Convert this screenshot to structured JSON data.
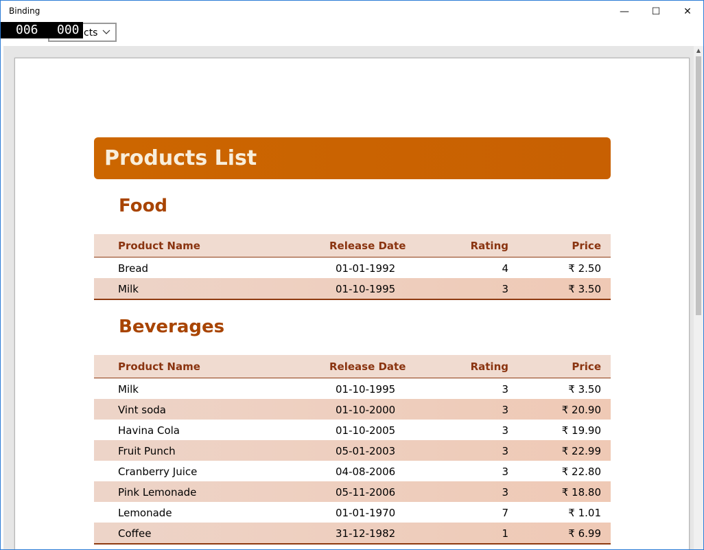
{
  "window": {
    "title": "Binding"
  },
  "controls": {
    "minimize": "—",
    "maximize": "☐",
    "close": "✕"
  },
  "fps": {
    "a": "006",
    "b": "000"
  },
  "dropdown": {
    "value_fragment": "cts",
    "chevron": "chevron-down-icon"
  },
  "report": {
    "banner_title": "Products List",
    "columns": {
      "name": "Product Name",
      "date": "Release Date",
      "rating": "Rating",
      "price": "Price"
    },
    "sections": [
      {
        "title": "Food",
        "rows": [
          {
            "name": "Bread",
            "date": "01-01-1992",
            "rating": "4",
            "price": "₹ 2.50"
          },
          {
            "name": "Milk",
            "date": "01-10-1995",
            "rating": "3",
            "price": "₹ 3.50"
          }
        ]
      },
      {
        "title": "Beverages",
        "rows": [
          {
            "name": "Milk",
            "date": "01-10-1995",
            "rating": "3",
            "price": "₹ 3.50"
          },
          {
            "name": "Vint soda",
            "date": "01-10-2000",
            "rating": "3",
            "price": "₹ 20.90"
          },
          {
            "name": "Havina Cola",
            "date": "01-10-2005",
            "rating": "3",
            "price": "₹ 19.90"
          },
          {
            "name": "Fruit Punch",
            "date": "05-01-2003",
            "rating": "3",
            "price": "₹ 22.99"
          },
          {
            "name": "Cranberry Juice",
            "date": "04-08-2006",
            "rating": "3",
            "price": "₹ 22.80"
          },
          {
            "name": "Pink Lemonade",
            "date": "05-11-2006",
            "rating": "3",
            "price": "₹ 18.80"
          },
          {
            "name": "Lemonade",
            "date": "01-01-1970",
            "rating": "7",
            "price": "₹ 1.01"
          },
          {
            "name": "Coffee",
            "date": "31-12-1982",
            "rating": "1",
            "price": "₹ 6.99"
          }
        ]
      }
    ]
  },
  "colors": {
    "banner": "#cc6600",
    "header_text": "#8a3410",
    "section_title": "#a84400"
  }
}
